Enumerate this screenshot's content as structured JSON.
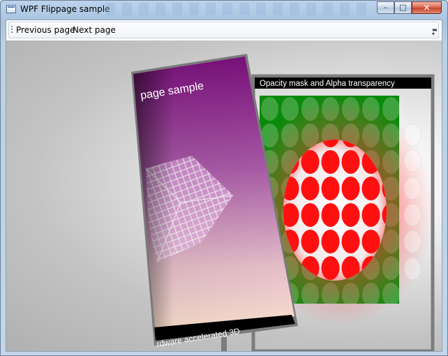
{
  "window": {
    "title": "WPF Flippage sample"
  },
  "toolbar": {
    "previous_label": "Previous page",
    "next_label": "Next page"
  },
  "pages": {
    "back_banner": "Opacity mask and Alpha transparency",
    "front_title": "page sample",
    "front_footer": "rdware accelerated 3D"
  },
  "caption": {
    "minimize": "–",
    "maximize": "□",
    "close": "✕"
  },
  "colors": {
    "purple": "#80157f",
    "green": "#008a00",
    "red": "#ff0000"
  }
}
